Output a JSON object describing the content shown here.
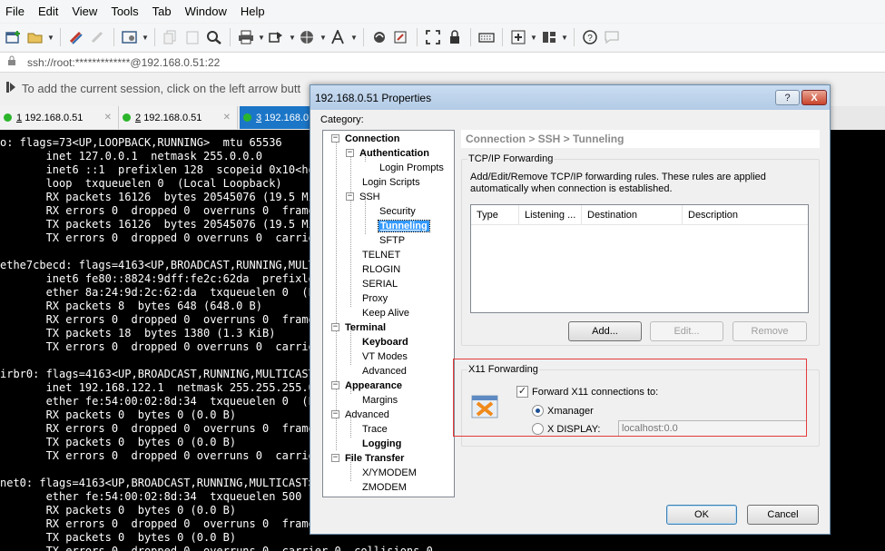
{
  "menu": [
    "File",
    "Edit",
    "View",
    "Tools",
    "Tab",
    "Window",
    "Help"
  ],
  "address": "ssh://root:*************@192.168.0.51:22",
  "infobar": "To add the current session, click on the left arrow butt",
  "tabs": [
    {
      "number": "1",
      "label": "192.168.0.51"
    },
    {
      "number": "2",
      "label": "192.168.0.51"
    },
    {
      "number": "3",
      "label": "192.168.0"
    }
  ],
  "terminal_lines": [
    "o: flags=73<UP,LOOPBACK,RUNNING>  mtu 65536",
    "       inet 127.0.0.1  netmask 255.0.0.0",
    "       inet6 ::1  prefixlen 128  scopeid 0x10<hos",
    "       loop  txqueuelen 0  (Local Loopback)",
    "       RX packets 16126  bytes 20545076 (19.5 MiB",
    "       RX errors 0  dropped 0  overruns 0  frame",
    "       TX packets 16126  bytes 20545076 (19.5 Mi",
    "       TX errors 0  dropped 0 overruns 0  carrier",
    "",
    "ethe7cbecd: flags=4163<UP,BROADCAST,RUNNING,MULTI",
    "       inet6 fe80::8824:9dff:fe2c:62da  prefixler",
    "       ether 8a:24:9d:2c:62:da  txqueuelen 0  (Et",
    "       RX packets 8  bytes 648 (648.0 B)",
    "       RX errors 0  dropped 0  overruns 0  frame",
    "       TX packets 18  bytes 1380 (1.3 KiB)",
    "       TX errors 0  dropped 0 overruns 0  carrier",
    "",
    "irbr0: flags=4163<UP,BROADCAST,RUNNING,MULTICAST>",
    "       inet 192.168.122.1  netmask 255.255.255.0",
    "       ether fe:54:00:02:8d:34  txqueuelen 0  (E",
    "       RX packets 0  bytes 0 (0.0 B)",
    "       RX errors 0  dropped 0  overruns 0  frame",
    "       TX packets 0  bytes 0 (0.0 B)",
    "       TX errors 0  dropped 0 overruns 0  carrier",
    "",
    "net0: flags=4163<UP,BROADCAST,RUNNING,MULTICAST>",
    "       ether fe:54:00:02:8d:34  txqueuelen 500  (",
    "       RX packets 0  bytes 0 (0.0 B)",
    "       RX errors 0  dropped 0  overruns 0  frame",
    "       TX packets 0  bytes 0 (0.0 B)",
    "       TX errors 0  dropped 0  overruns 0  carrier 0  collisions 0"
  ],
  "dialog": {
    "title": "192.168.0.51 Properties",
    "help": "?",
    "close": "X",
    "category_label": "Category:",
    "tree": {
      "connection": "Connection",
      "authentication": "Authentication",
      "login_prompts": "Login Prompts",
      "login_scripts": "Login Scripts",
      "ssh": "SSH",
      "security": "Security",
      "tunneling": "Tunneling",
      "sftp": "SFTP",
      "telnet": "TELNET",
      "rlogin": "RLOGIN",
      "serial": "SERIAL",
      "proxy": "Proxy",
      "keep_alive": "Keep Alive",
      "terminal": "Terminal",
      "keyboard": "Keyboard",
      "vt_modes": "VT Modes",
      "advanced_terminal": "Advanced",
      "appearance": "Appearance",
      "margins": "Margins",
      "advanced": "Advanced",
      "trace": "Trace",
      "logging": "Logging",
      "file_transfer": "File Transfer",
      "xymodem": "X/YMODEM",
      "zmodem": "ZMODEM"
    },
    "breadcrumb": "Connection > SSH > Tunneling",
    "tcp_group": "TCP/IP Forwarding",
    "tcp_desc": "Add/Edit/Remove TCP/IP forwarding rules. These rules are applied automatically when connection is established.",
    "columns": [
      "Type",
      "Listening ...",
      "Destination",
      "Description"
    ],
    "add_button": "Add...",
    "edit_button": "Edit...",
    "remove_button": "Remove",
    "x11_group": "X11 Forwarding",
    "forward_x11": "Forward X11 connections to:",
    "xmanager": "Xmanager",
    "xdisplay": "X DISPLAY:",
    "xdisplay_value": "localhost:0.0",
    "ok": "OK",
    "cancel": "Cancel"
  }
}
